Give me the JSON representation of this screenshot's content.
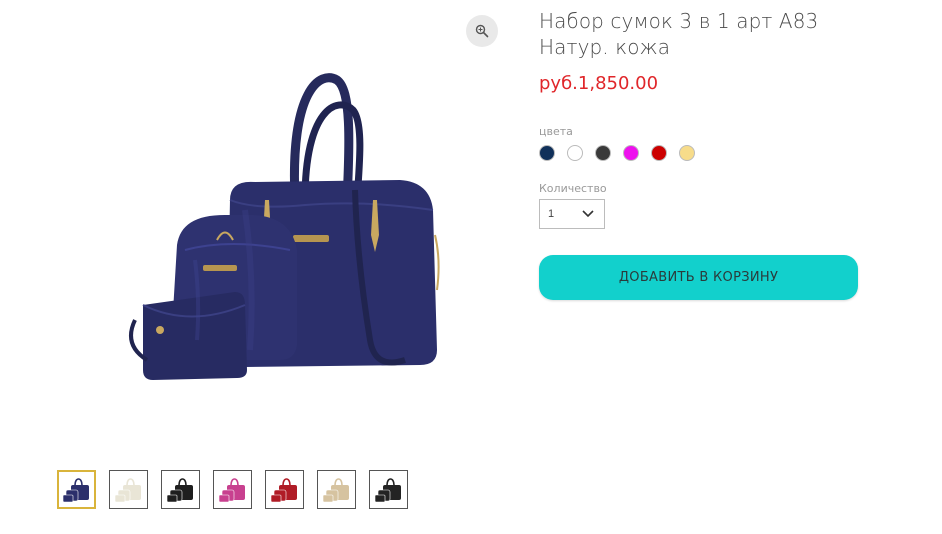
{
  "product": {
    "title": "Набор сумок 3 в 1 арт A83 Натур. кожа",
    "price": "руб.1,850.00"
  },
  "colors": {
    "label": "цвета",
    "options": [
      {
        "name": "navy",
        "hex": "#10305a"
      },
      {
        "name": "white",
        "hex": "#ffffff"
      },
      {
        "name": "dark-gray",
        "hex": "#3a3a3a"
      },
      {
        "name": "magenta",
        "hex": "#ee11ee"
      },
      {
        "name": "red",
        "hex": "#cc0000"
      },
      {
        "name": "cream",
        "hex": "#f7dc8a"
      }
    ]
  },
  "quantity": {
    "label": "Количество",
    "value": "1"
  },
  "cart": {
    "add_label": "ДОБАВИТЬ В КОРЗИНУ",
    "button_color": "#12d0cc"
  },
  "gallery": {
    "zoom_icon": "magnifier-icon",
    "main_bag_color": "#2b2f6b",
    "thumbnails": [
      {
        "variant": "navy",
        "color": "#2b2f6b",
        "active": true
      },
      {
        "variant": "white",
        "color": "#e9e5d6",
        "active": false
      },
      {
        "variant": "black",
        "color": "#1e1e1e",
        "active": false
      },
      {
        "variant": "pink",
        "color": "#c8408f",
        "active": false
      },
      {
        "variant": "red",
        "color": "#b01c26",
        "active": false
      },
      {
        "variant": "beige",
        "color": "#d6c3a0",
        "active": false
      },
      {
        "variant": "black-detail",
        "color": "#232323",
        "active": false
      }
    ]
  }
}
